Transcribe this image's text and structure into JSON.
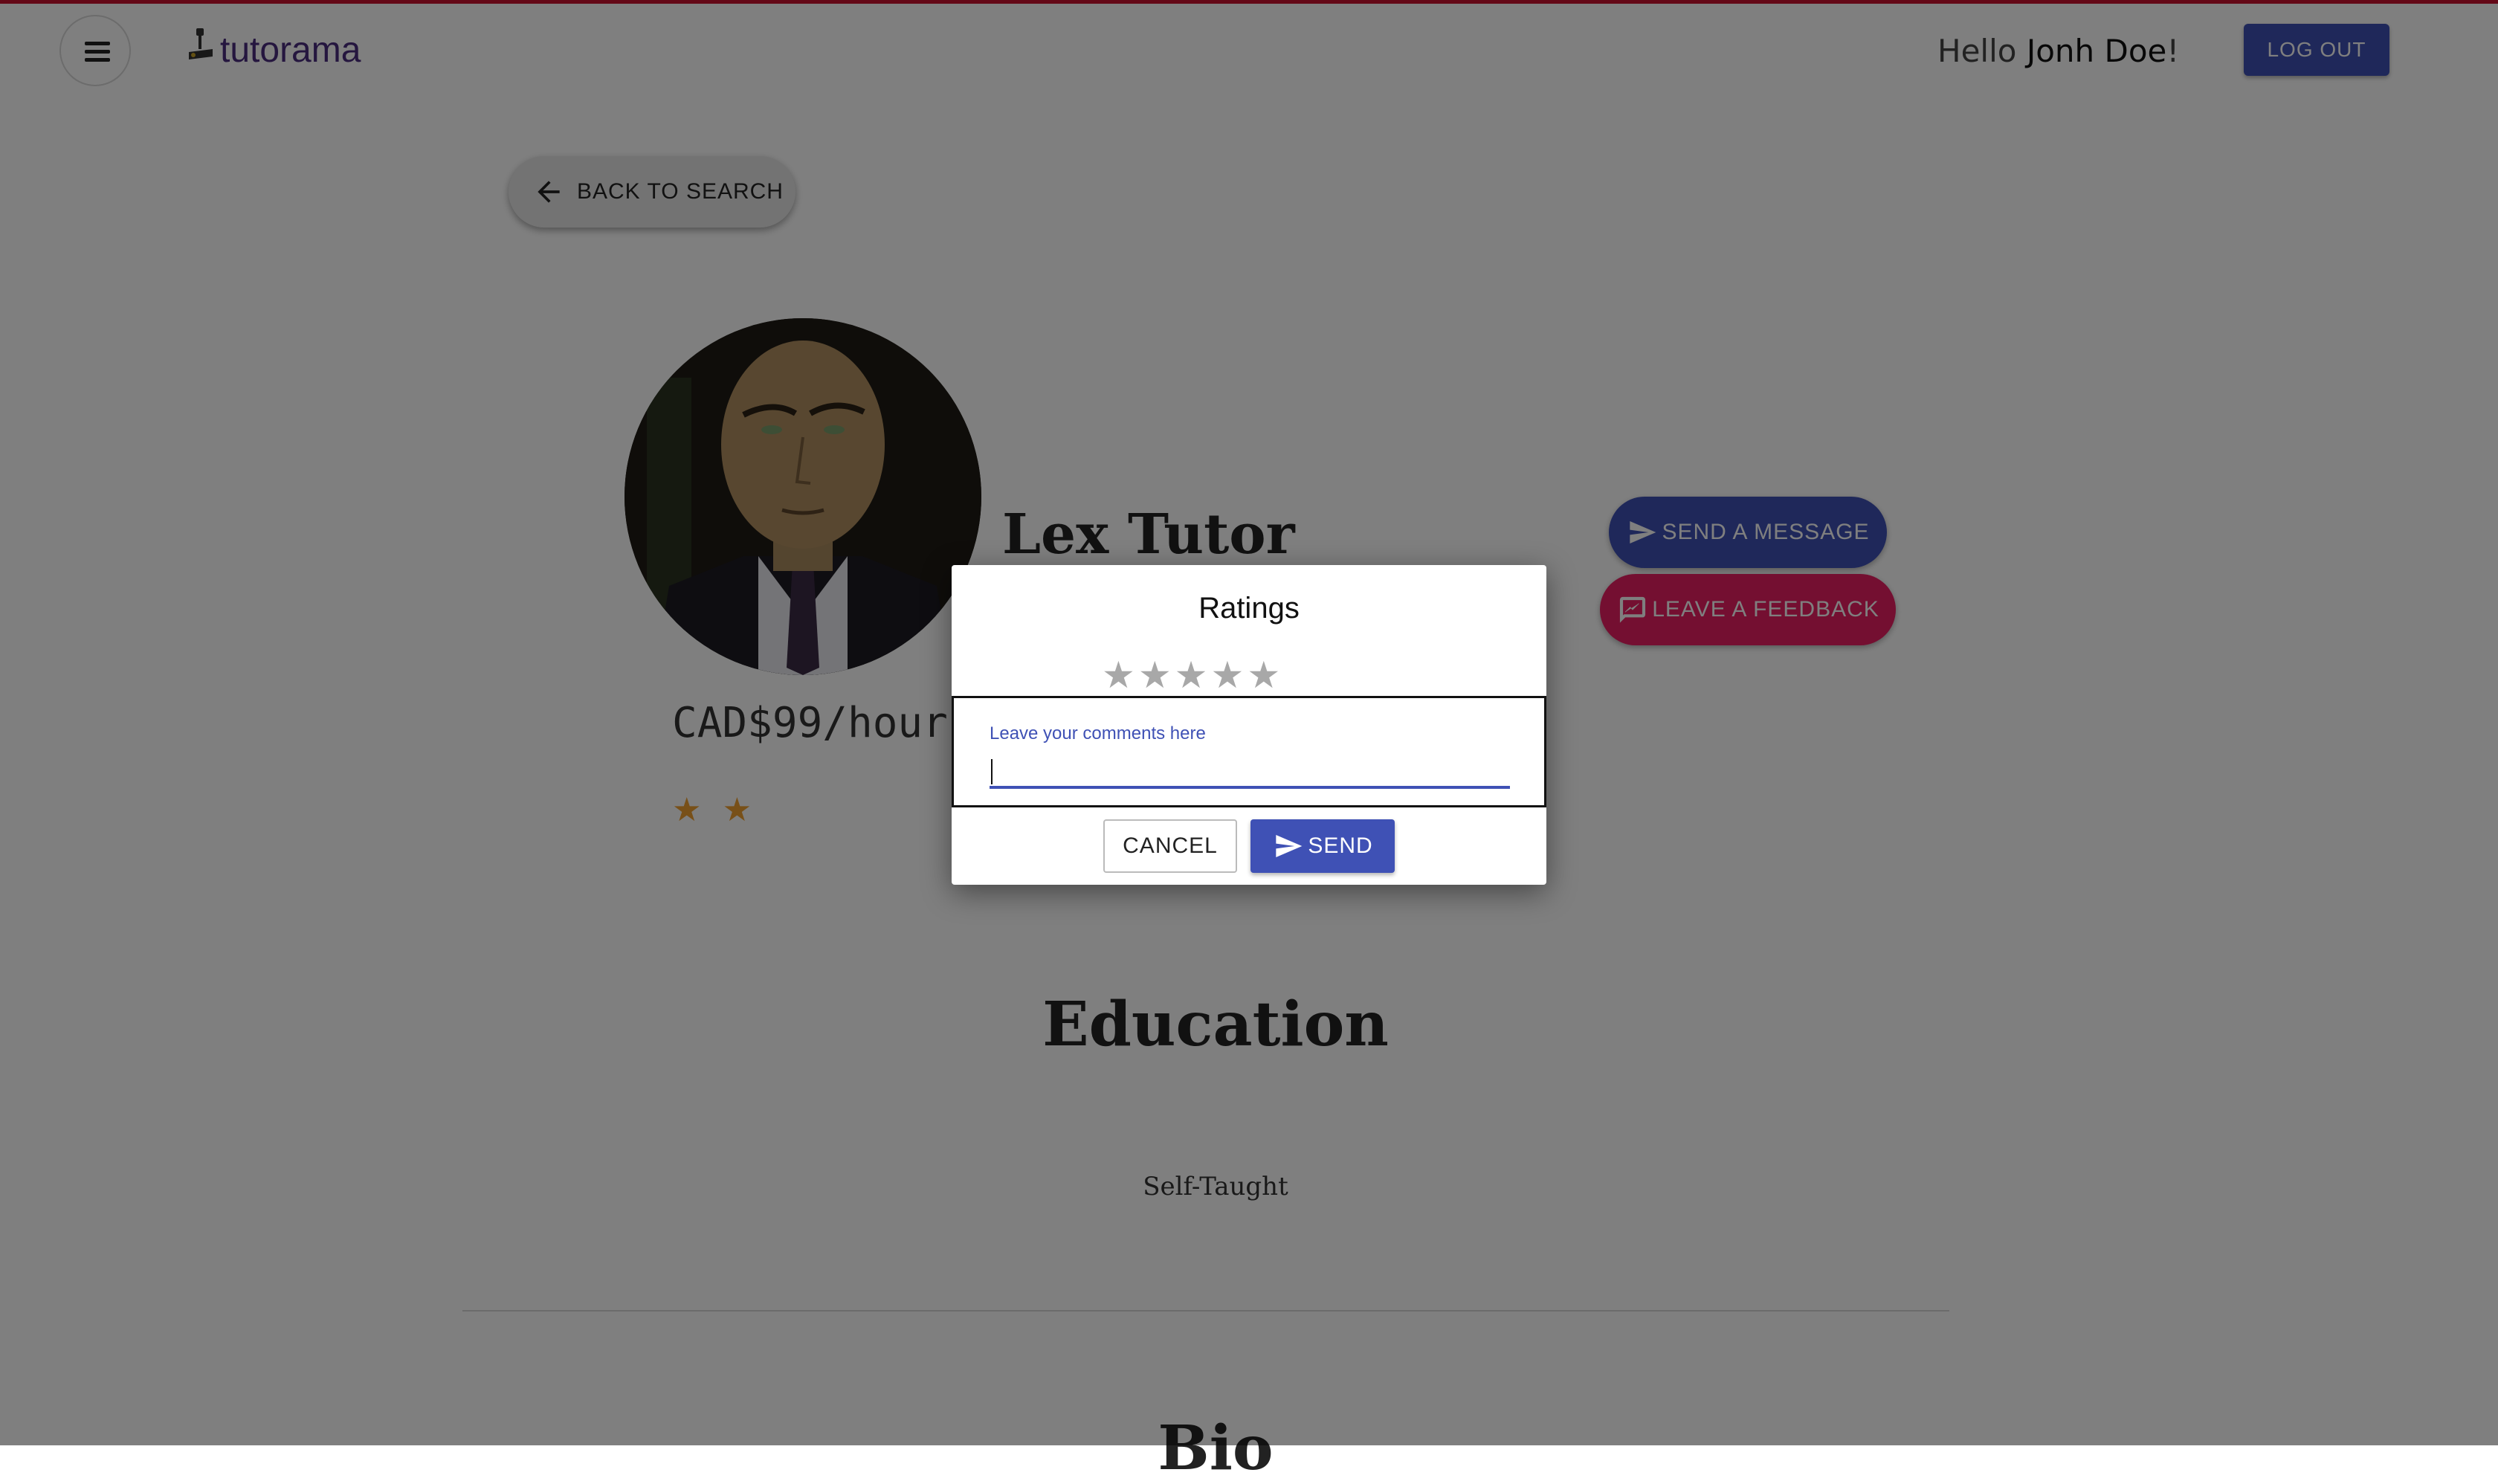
{
  "header": {
    "logo_text": "tutorama",
    "greeting": "Hello",
    "user_name": "Jonh Doe",
    "greeting_suffix": "!",
    "logout_label": "LOG OUT"
  },
  "back_button": {
    "label": "BACK TO SEARCH",
    "icon": "arrow-left-icon"
  },
  "profile": {
    "name": "Lex Tutor",
    "price": "CAD$99/hour",
    "rating_stars": "★ ★",
    "rating_value": 2,
    "send_message_label": "SEND A MESSAGE",
    "leave_feedback_label": "LEAVE A FEEDBACK"
  },
  "sections": {
    "education_title": "Education",
    "education_text": "Self-Taught",
    "bio_title": "Bio"
  },
  "dialog": {
    "title": "Ratings",
    "stars": [
      "★",
      "★",
      "★",
      "★",
      "★"
    ],
    "selected_rating": 0,
    "comment_label": "Leave your comments here",
    "comment_value": "",
    "cancel_label": "CANCEL",
    "send_label": "SEND"
  },
  "colors": {
    "primary": "#3f51b5",
    "secondary": "#e91e63",
    "top_line": "#c8102e",
    "star_filled": "#f0a030",
    "star_empty": "#a8a8a8"
  }
}
